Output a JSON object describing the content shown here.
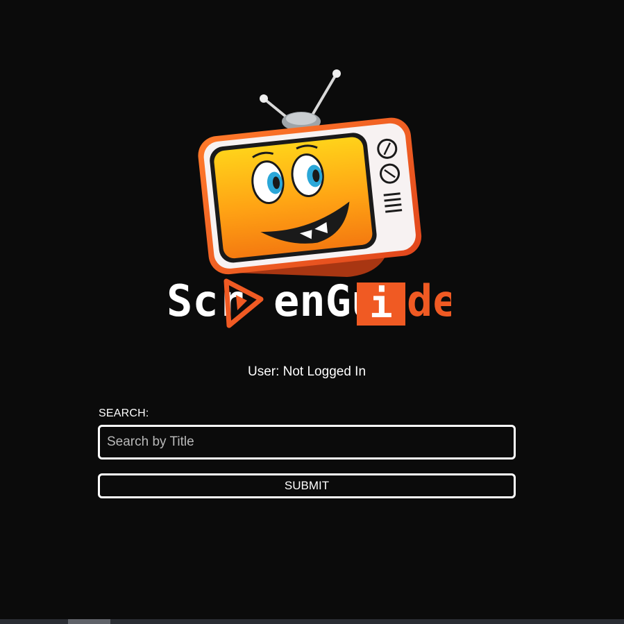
{
  "logo": {
    "text_part1": "Scr",
    "text_part2": "enGu",
    "text_part3": "i",
    "text_part4": "de",
    "brand_orange": "#f05a23",
    "screen_yellow": "#ffb100"
  },
  "user_status": "User: Not Logged In",
  "search": {
    "label": "SEARCH:",
    "placeholder": "Search by Title",
    "value": ""
  },
  "submit": {
    "label": "SUBMIT"
  }
}
